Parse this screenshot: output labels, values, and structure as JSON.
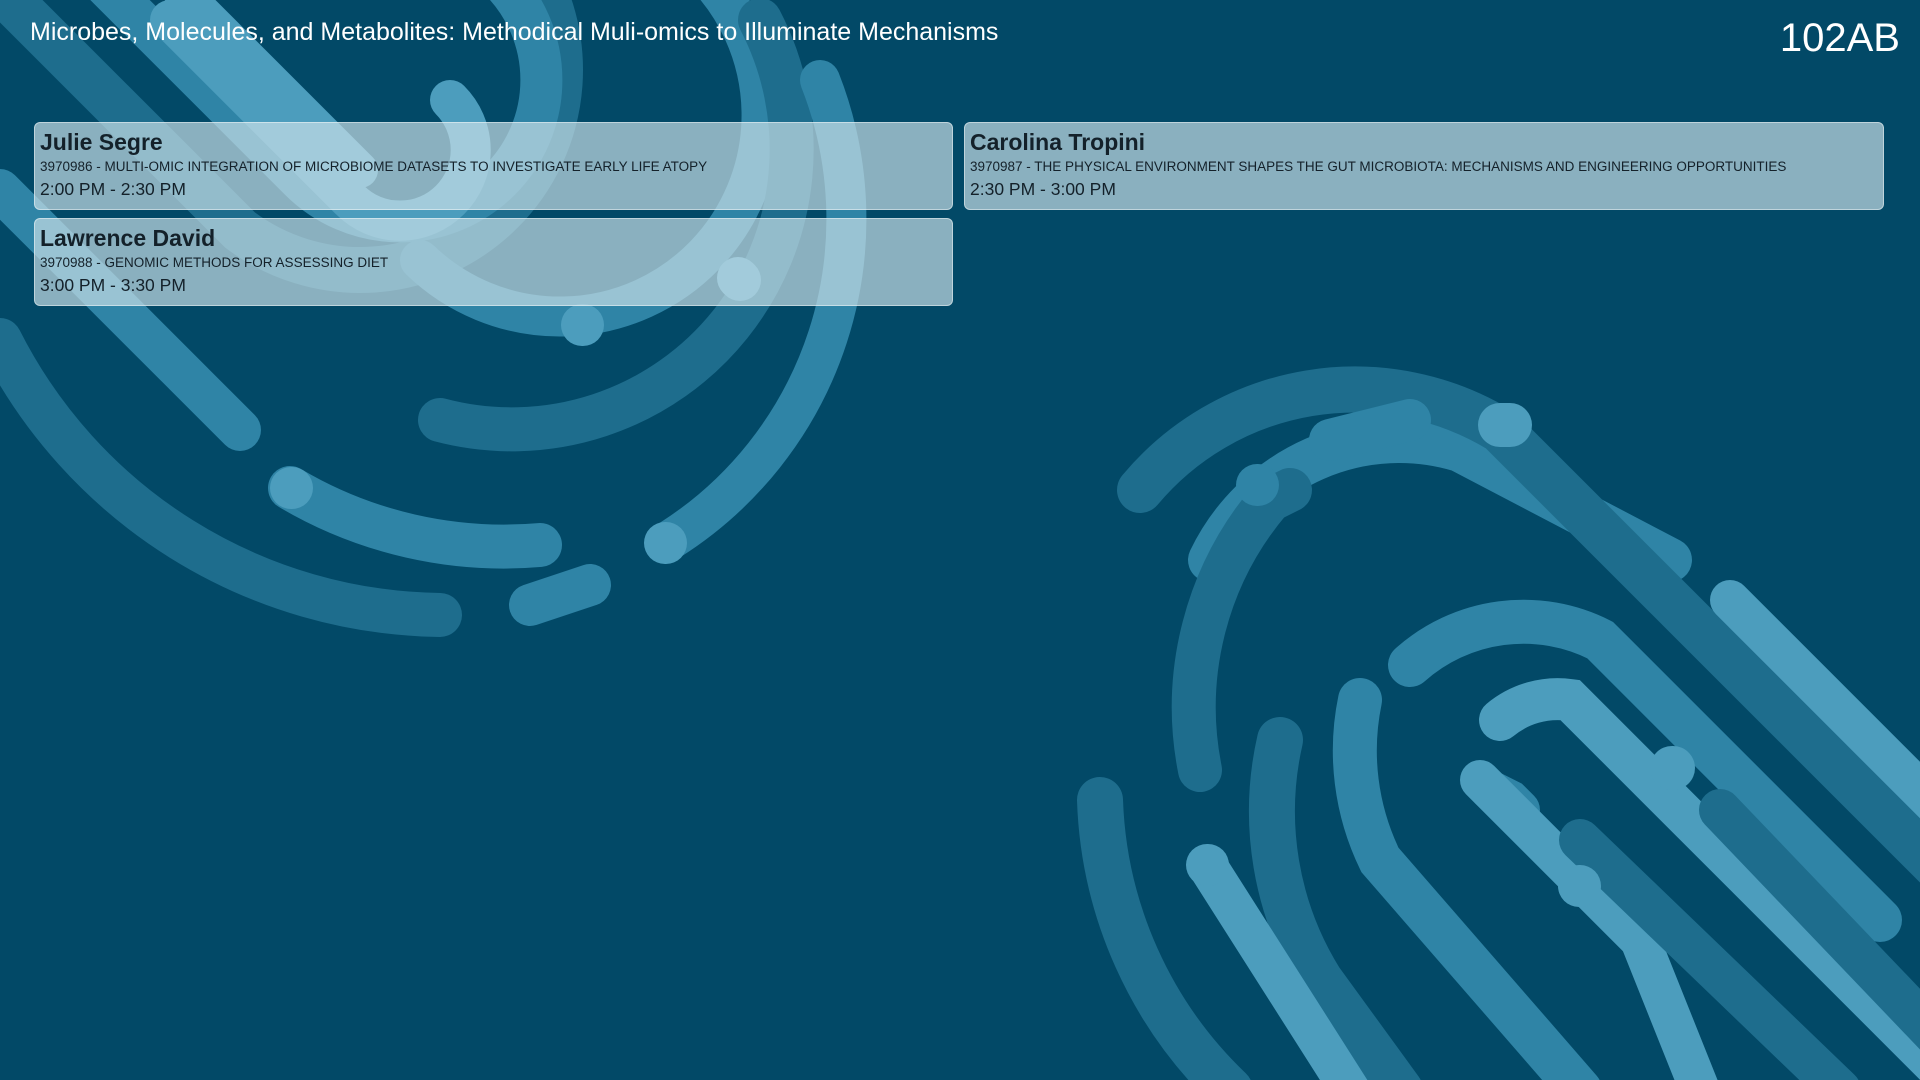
{
  "header": {
    "title": "Microbes, Molecules, and Metabolites: Methodical Muli-omics to Illuminate Mechanisms",
    "room": "102AB"
  },
  "sessions": [
    {
      "speaker": "Julie Segre",
      "abstract": "3970986 - MULTI-OMIC INTEGRATION OF MICROBIOME DATASETS TO INVESTIGATE EARLY LIFE ATOPY",
      "time": "2:00 PM - 2:30 PM"
    },
    {
      "speaker": "Carolina Tropini",
      "abstract": "3970987 - THE PHYSICAL ENVIRONMENT SHAPES THE GUT MICROBIOTA: MECHANISMS AND ENGINEERING OPPORTUNITIES",
      "time": "2:30 PM - 3:00 PM"
    },
    {
      "speaker": "Lawrence David",
      "abstract": "3970988 - GENOMIC METHODS FOR ASSESSING DIET",
      "time": "3:00 PM - 3:30 PM"
    }
  ],
  "colors": {
    "background": "#024967",
    "card": "#cbe2e9",
    "pattern_dark": "#1e6d8d",
    "pattern_mid": "#2f84a6",
    "pattern_light": "#4c9dbd"
  },
  "icons": [
    "fingerprint-pattern-top-left",
    "fingerprint-pattern-bottom-right"
  ]
}
